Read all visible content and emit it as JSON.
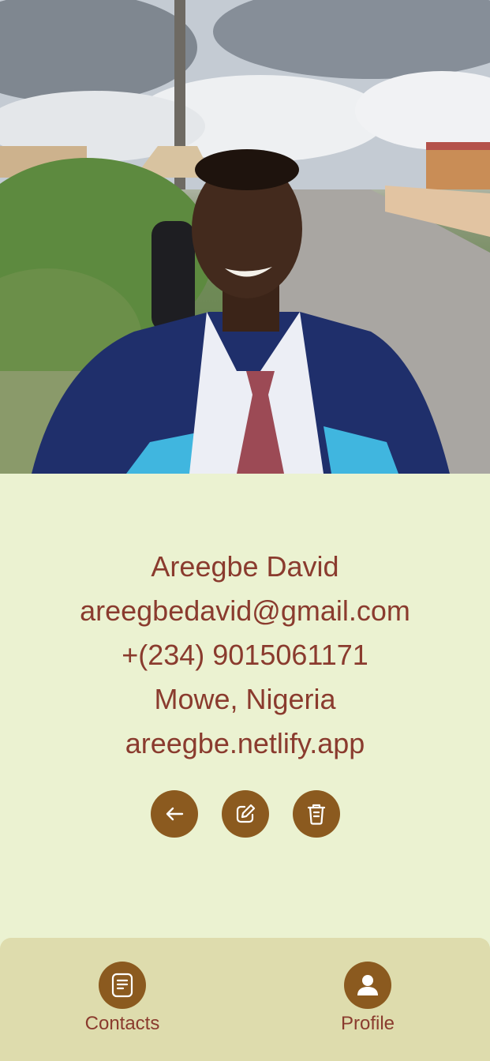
{
  "profile": {
    "photo_description": "",
    "name": "Areegbe David",
    "email": "areegbedavid@gmail.com",
    "phone": "+(234) 9015061171",
    "location": "Mowe, Nigeria",
    "website": "areegbe.netlify.app"
  },
  "actions": {
    "back_icon": "arrow-left-icon",
    "edit_icon": "edit-icon",
    "delete_icon": "trash-icon"
  },
  "nav": {
    "contacts_label": "Contacts",
    "profile_label": "Profile",
    "contacts_icon": "document-icon",
    "profile_icon": "person-icon"
  },
  "colors": {
    "background": "#ebf2d1",
    "text": "#8a3b2e",
    "accent": "#8b5a1f",
    "nav_background": "#dedcad"
  }
}
